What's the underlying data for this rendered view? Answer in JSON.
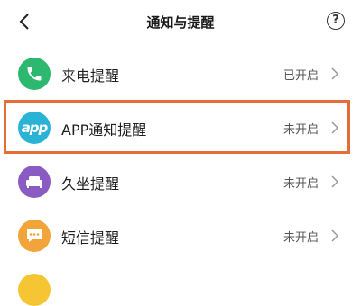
{
  "header": {
    "title": "通知与提醒",
    "back_icon": "chevron-left-icon",
    "help_label": "?"
  },
  "items": [
    {
      "label": "来电提醒",
      "status": "已开启",
      "icon": "phone-icon",
      "color": "#2db870"
    },
    {
      "label": "APP通知提醒",
      "status": "未开启",
      "icon": "app-icon",
      "icon_text": "app",
      "color": "#2bb3d6",
      "highlighted": true
    },
    {
      "label": "久坐提醒",
      "status": "未开启",
      "icon": "sofa-icon",
      "color": "#8a5bc2"
    },
    {
      "label": "短信提醒",
      "status": "未开启",
      "icon": "message-icon",
      "color": "#f2a33a"
    }
  ],
  "colors": {
    "highlight_border": "#e56e38",
    "partial_icon": "#f5c533"
  }
}
